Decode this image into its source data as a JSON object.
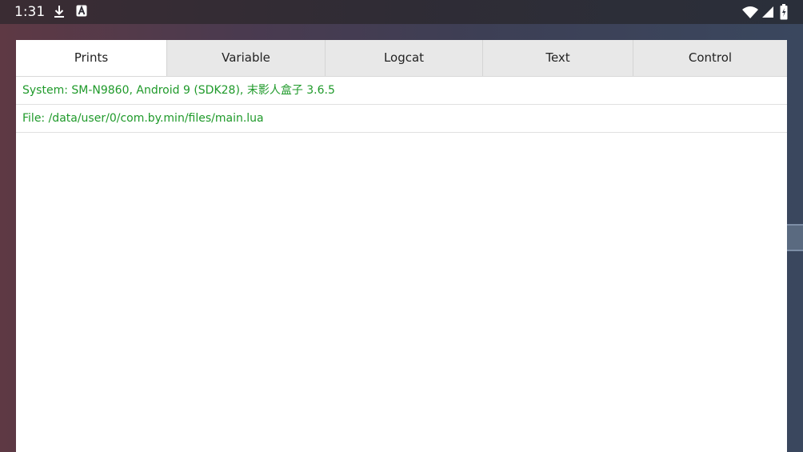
{
  "status_bar": {
    "time": "1:31",
    "icons": [
      "download-icon",
      "a-notification-icon",
      "wifi-icon",
      "cell-signal-icon",
      "battery-icon"
    ]
  },
  "tabs": [
    {
      "label": "Prints",
      "active": true
    },
    {
      "label": "Variable",
      "active": false
    },
    {
      "label": "Logcat",
      "active": false
    },
    {
      "label": "Text",
      "active": false
    },
    {
      "label": "Control",
      "active": false
    }
  ],
  "log": {
    "lines": [
      "System: SM-N9860, Android 9 (SDK28), 末影人盒子 3.6.5",
      "File: /data/user/0/com.by.min/files/main.lua"
    ],
    "text_color": "#1f9a2a"
  }
}
